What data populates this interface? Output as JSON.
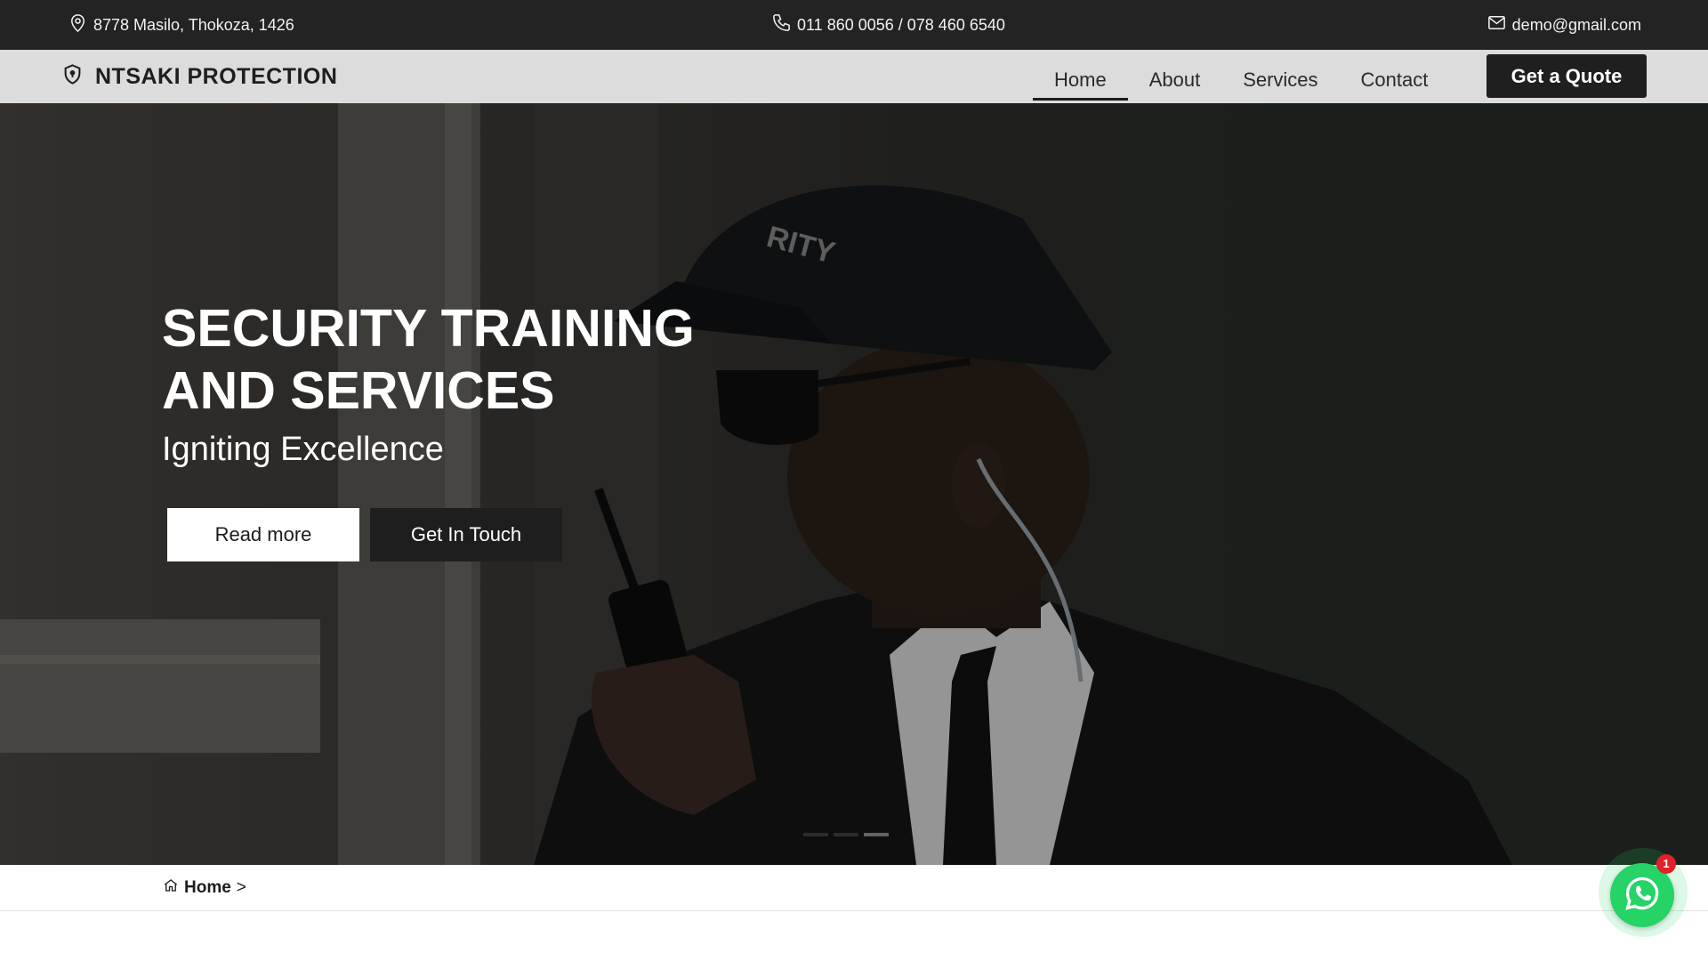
{
  "topbar": {
    "address": "8778 Masilo, Thokoza, 1426",
    "address_icon": "map-pin-icon",
    "phone": "011 860 0056 / 078 460 6540",
    "phone_icon": "phone-icon",
    "email": "demo@gmail.com",
    "email_icon": "mail-icon"
  },
  "navbar": {
    "brand_icon": "shield-icon",
    "brand": "NTSAKI PROTECTION",
    "links": [
      {
        "label": "Home",
        "active": true
      },
      {
        "label": "About",
        "active": false
      },
      {
        "label": "Services",
        "active": false
      },
      {
        "label": "Contact",
        "active": false
      }
    ],
    "cta": "Get a Quote"
  },
  "hero": {
    "title": "SECURITY TRAINING AND SERVICES",
    "subtitle": "Igniting Excellence",
    "primary_button": "Read more",
    "secondary_button": "Get In Touch",
    "background": "security guard in black cap and jacket speaking into a walkie-talkie",
    "slides": 3,
    "active_slide": 3
  },
  "breadcrumb": {
    "home_icon": "home-icon",
    "home": "Home",
    "separator": ">"
  },
  "whatsapp": {
    "icon": "whatsapp-icon",
    "badge": "1"
  },
  "colors": {
    "topbar_bg": "#232323",
    "navbar_bg": "#dcdcdc",
    "dark_button": "#1e1e1e",
    "whatsapp_green": "#25d366",
    "badge_red": "#e0202a"
  }
}
